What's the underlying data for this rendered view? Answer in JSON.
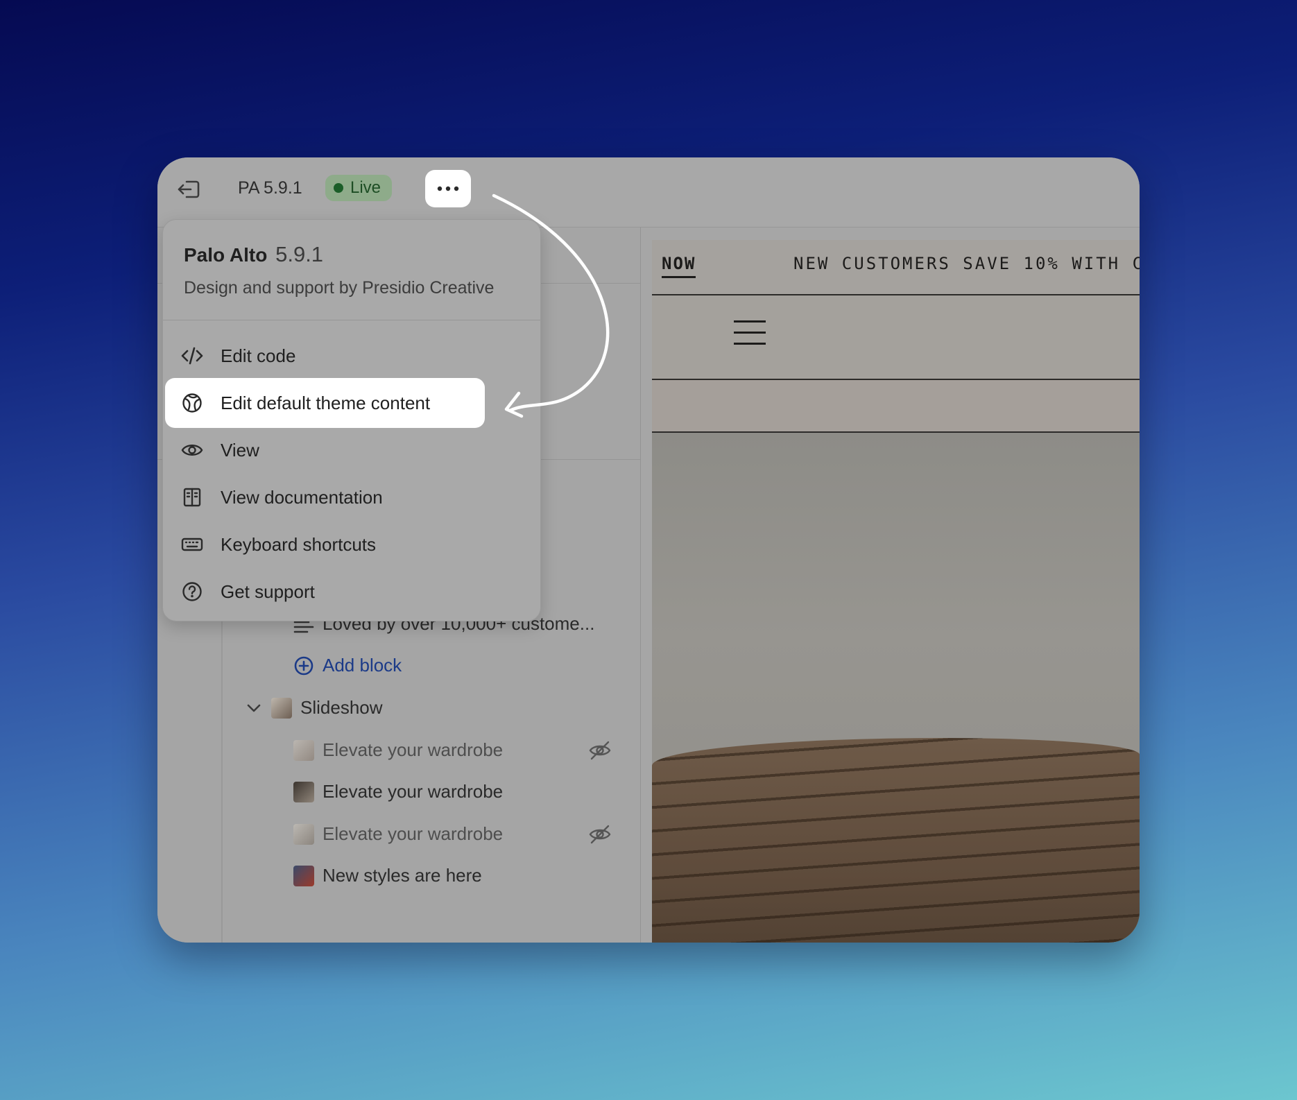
{
  "topbar": {
    "theme_short": "PA 5.9.1",
    "status": "Live",
    "status_color": "#1b5e28",
    "exit_icon": "exit-icon",
    "more_icon": "ellipsis-icon"
  },
  "menu": {
    "theme_name": "Palo Alto",
    "theme_version": "5.9.1",
    "subtitle": "Design and support by Presidio Creative",
    "items": [
      {
        "label": "Edit code",
        "icon": "code-icon"
      },
      {
        "label": "Edit default theme content",
        "icon": "globe-icon",
        "active": true
      },
      {
        "label": "View",
        "icon": "eye-icon"
      },
      {
        "label": "View documentation",
        "icon": "book-icon"
      },
      {
        "label": "Keyboard shortcuts",
        "icon": "keyboard-icon"
      },
      {
        "label": "Get support",
        "icon": "question-icon"
      }
    ]
  },
  "sidebar": {
    "text_block": "Loved by over 10,000+ custome...",
    "add_block": "Add block",
    "slideshow": "Slideshow",
    "slides": [
      {
        "label": "Elevate your wardrobe",
        "hidden": true
      },
      {
        "label": "Elevate your wardrobe",
        "hidden": false
      },
      {
        "label": "Elevate your wardrobe",
        "hidden": true
      },
      {
        "label": "New styles are here",
        "hidden": false
      }
    ]
  },
  "preview": {
    "announcement_now": "NOW",
    "announcement_text": "NEW CUSTOMERS SAVE 10% WITH C"
  }
}
